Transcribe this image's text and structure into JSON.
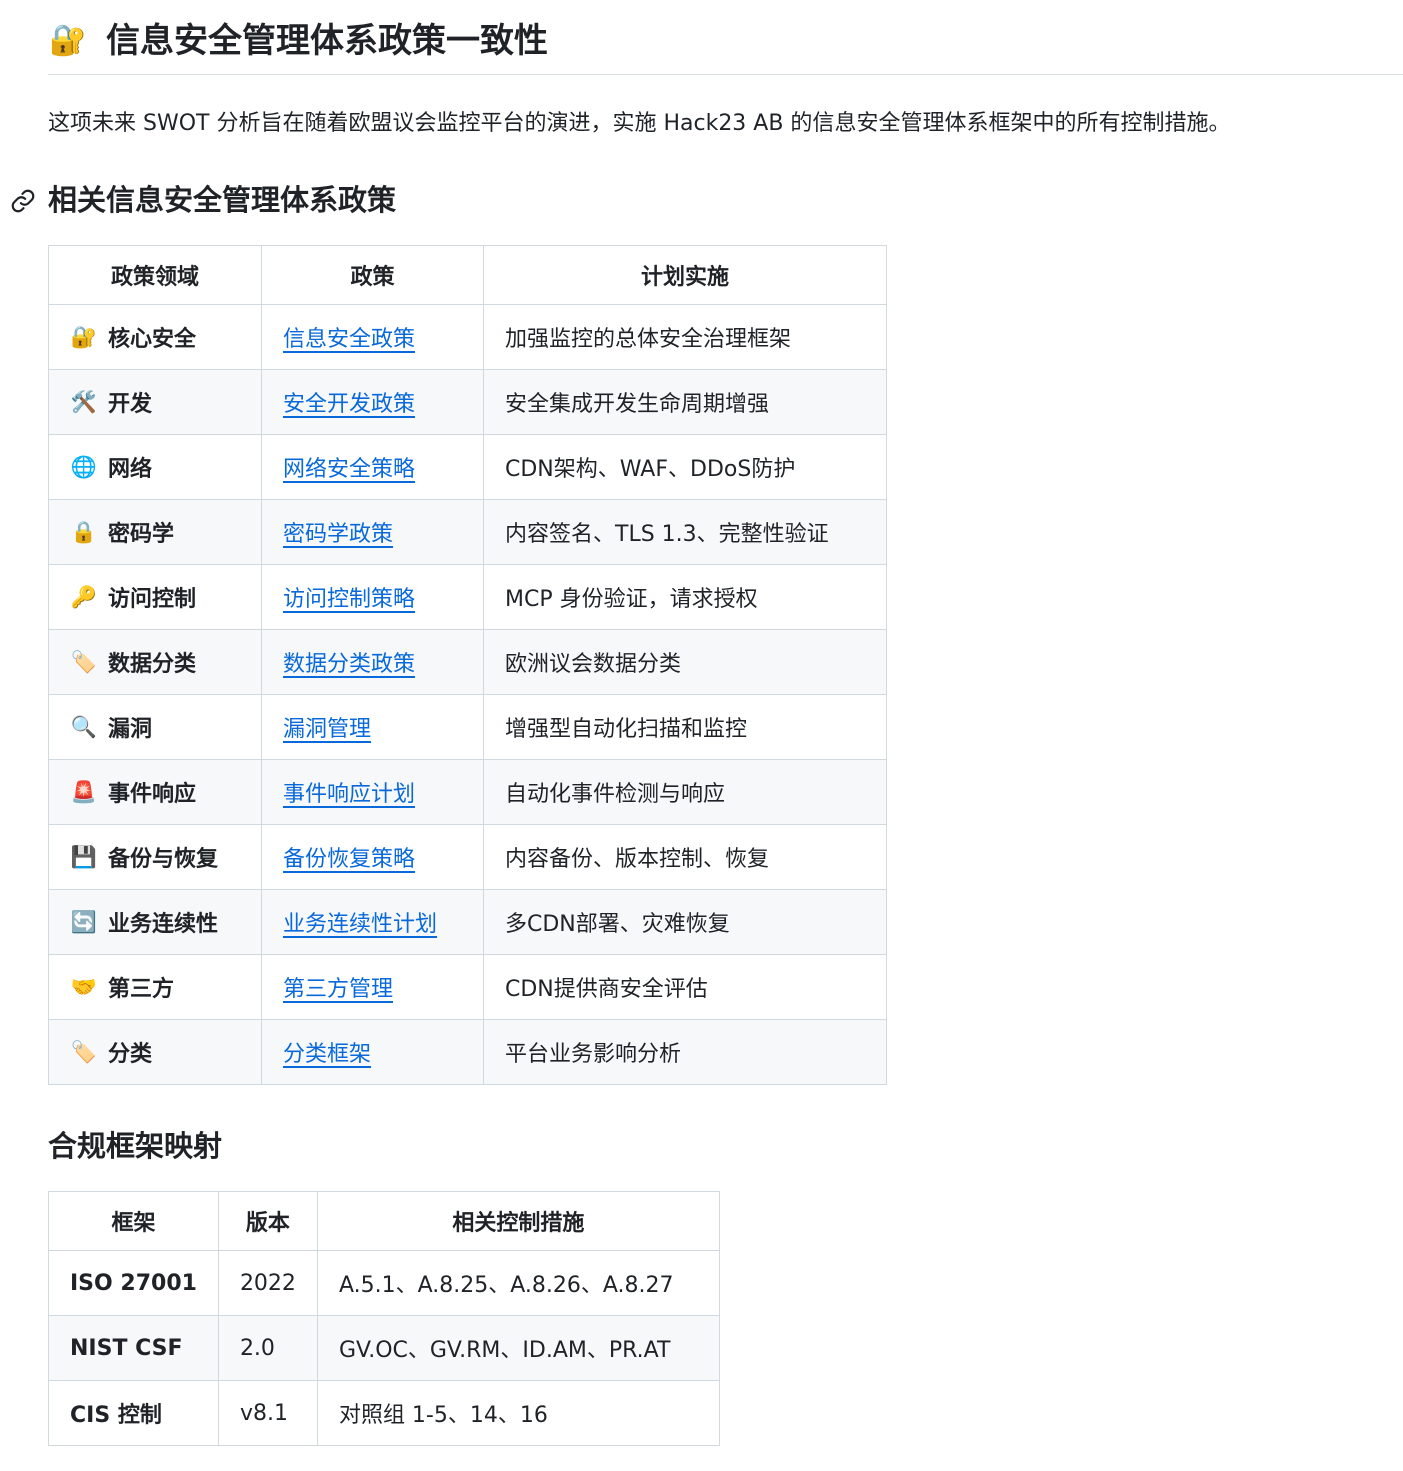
{
  "title": {
    "icon": "🔐",
    "text": "信息安全管理体系政策一致性"
  },
  "intro": "这项未来 SWOT 分析旨在随着欧盟议会监控平台的演进，实施 Hack23 AB 的信息安全管理体系框架中的所有控制措施。",
  "policies_section": {
    "heading": "相关信息安全管理体系政策",
    "headers": [
      "政策领域",
      "政策",
      "计划实施"
    ],
    "rows": [
      {
        "icon": "🔐",
        "area": "核心安全",
        "policy": "信息安全政策",
        "implementation": "加强监控的总体安全治理框架"
      },
      {
        "icon": "🛠️",
        "area": "开发",
        "policy": "安全开发政策",
        "implementation": "安全集成开发生命周期增强"
      },
      {
        "icon": "🌐",
        "area": "网络",
        "policy": "网络安全策略",
        "implementation": "CDN架构、WAF、DDoS防护"
      },
      {
        "icon": "🔒",
        "area": "密码学",
        "policy": "密码学政策",
        "implementation": "内容签名、TLS 1.3、完整性验证"
      },
      {
        "icon": "🔑",
        "area": "访问控制",
        "policy": "访问控制策略",
        "implementation": "MCP 身份验证，请求授权"
      },
      {
        "icon": "🏷️",
        "area": "数据分类",
        "policy": "数据分类政策",
        "implementation": "欧洲议会数据分类"
      },
      {
        "icon": "🔍",
        "area": "漏洞",
        "policy": "漏洞管理",
        "implementation": "增强型自动化扫描和监控"
      },
      {
        "icon": "🚨",
        "area": "事件响应",
        "policy": "事件响应计划",
        "implementation": "自动化事件检测与响应"
      },
      {
        "icon": "💾",
        "area": "备份与恢复",
        "policy": "备份恢复策略",
        "implementation": "内容备份、版本控制、恢复"
      },
      {
        "icon": "🔄",
        "area": "业务连续性",
        "policy": "业务连续性计划",
        "implementation": "多CDN部署、灾难恢复"
      },
      {
        "icon": "🤝",
        "area": "第三方",
        "policy": "第三方管理",
        "implementation": "CDN提供商安全评估"
      },
      {
        "icon": "🏷️",
        "area": "分类",
        "policy": "分类框架",
        "implementation": "平台业务影响分析"
      }
    ]
  },
  "frameworks_section": {
    "heading": "合规框架映射",
    "headers": [
      "框架",
      "版本",
      "相关控制措施"
    ],
    "rows": [
      {
        "framework": "ISO 27001",
        "version": "2022",
        "controls": "A.5.1、A.8.25、A.8.26、A.8.27"
      },
      {
        "framework": "NIST CSF",
        "version": "2.0",
        "controls": "GV.OC、GV.RM、ID.AM、PR.AT"
      },
      {
        "framework": "CIS 控制",
        "version": "v8.1",
        "controls": "对照组 1-5、14、16"
      }
    ]
  }
}
